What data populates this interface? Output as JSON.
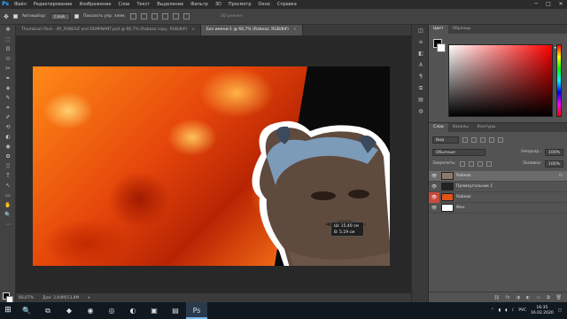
{
  "app": {
    "logo": "Ps"
  },
  "menu": [
    "Файл",
    "Редактирование",
    "Изображение",
    "Слои",
    "Текст",
    "Выделение",
    "Фильтр",
    "3D",
    "Просмотр",
    "Окно",
    "Справка"
  ],
  "window_controls": {
    "minimize": "─",
    "maximize": "□",
    "close": "✕"
  },
  "options_bar": {
    "tool_icon": "move-tool-icon",
    "autoselect_label": "Автовыбор:",
    "autoselect_value": "Слой",
    "transform_label": "Показать упр. элем.",
    "mode_3d_label": "3D-режим:"
  },
  "tools": [
    "✥",
    "⬚",
    "ʘ",
    "⬭",
    "✂",
    "✒",
    "◈",
    "✎",
    "⌗",
    "✐",
    "⟲",
    "◐",
    "◉",
    "✿",
    "⬯",
    "T",
    "↖",
    "▭",
    "✋",
    "🔍",
    "⋯"
  ],
  "tabs": [
    {
      "label": "Thumbnail Pack - BY_RABEAZ and DOMINANT.psd @ 66,7% (Rabeaz copy, RGB/8#)",
      "active": false,
      "close": "×"
    },
    {
      "label": "Без имени-1 @ 66,7% (Rabeaz, RGB/8#)",
      "active": true,
      "close": "×"
    }
  ],
  "measure": {
    "width": "15,40 см",
    "height": "5,19 см",
    "w_label": "Ш:",
    "h_label": "В:"
  },
  "status": {
    "zoom": "66,67%",
    "doc": "Док: 2,64М/13,8М",
    "arrow": "▸"
  },
  "strip_icons": [
    "◫",
    "≡",
    "◧",
    "A",
    "¶",
    "⧉",
    "▤",
    "◍"
  ],
  "color_panel": {
    "tabs": [
      "Цвет",
      "Образцы"
    ],
    "active_tab": 0,
    "hue_marker": "◂"
  },
  "layers_panel": {
    "tabs": [
      "Слои",
      "Каналы",
      "Контуры"
    ],
    "active_tab": 0,
    "filter_label": "Вид",
    "blend_mode": "Обычные",
    "opacity_label": "Непрозр.:",
    "opacity_value": "100%",
    "lock_label": "Закрепить:",
    "fill_label": "Заливка:",
    "fill_value": "100%",
    "layers": [
      {
        "name": "Rabeaz",
        "fx": "fx",
        "eye": "👁",
        "thumb": "#8a7a6c",
        "selected": true,
        "red_eye": false
      },
      {
        "name": "Прямоугольник 1",
        "fx": "",
        "eye": "👁",
        "thumb": "#222222",
        "selected": false,
        "red_eye": false
      },
      {
        "name": "Rabeaz",
        "fx": "",
        "eye": "👁",
        "thumb": "#e05418",
        "selected": false,
        "red_eye": true
      },
      {
        "name": "Фон",
        "fx": "",
        "eye": "👁",
        "thumb": "#ffffff",
        "selected": false,
        "red_eye": false
      }
    ],
    "footer_icons": [
      "⛓",
      "fx",
      "◑",
      "◐",
      "▭",
      "⧉",
      "🗑"
    ]
  },
  "taskbar": {
    "start": "⊞",
    "apps": [
      "🔍",
      "⧉",
      "◆",
      "◉",
      "◎",
      "◐",
      "▣",
      "▤",
      "Ps"
    ],
    "active_app": 8,
    "tray_icons": [
      "⌃",
      "▮",
      "◖",
      "♪"
    ],
    "language": "РУС",
    "time": "16:35",
    "date": "16.02.2020",
    "notification": "▢"
  }
}
